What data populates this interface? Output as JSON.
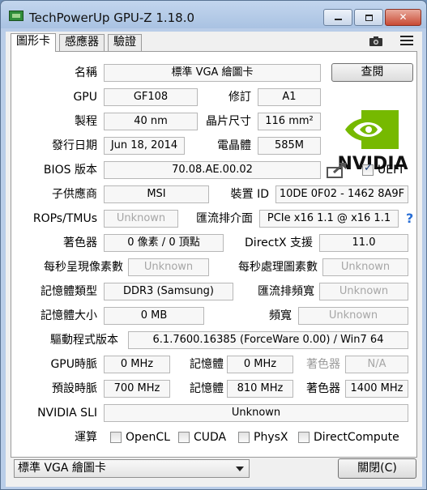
{
  "window": {
    "title": "TechPowerUp GPU-Z 1.18.0",
    "minimize_icon": "minimize-icon",
    "maximize_icon": "maximize-icon",
    "close_glyph": "✕"
  },
  "tabs": [
    {
      "label": "圖形卡",
      "active": true
    },
    {
      "label": "感應器",
      "active": false
    },
    {
      "label": "驗證",
      "active": false
    }
  ],
  "toolbar": {
    "camera_icon": "camera-icon",
    "menu_icon": "hamburger-menu-icon"
  },
  "card": {
    "name_label": "名稱",
    "name_value": "標準 VGA 繪圖卡",
    "lookup_button": "查閱",
    "gpu_label": "GPU",
    "gpu_value": "GF108",
    "revision_label": "修訂",
    "revision_value": "A1",
    "process_label": "製程",
    "process_value": "40 nm",
    "die_size_label": "晶片尺寸",
    "die_size_value": "116 mm²",
    "release_label": "發行日期",
    "release_value": "Jun 18, 2014",
    "transistors_label": "電晶體",
    "transistors_value": "585M",
    "bios_label": "BIOS 版本",
    "bios_value": "70.08.AE.00.02",
    "uefi_label": "UEFI",
    "uefi_checked": true,
    "subvendor_label": "子供應商",
    "subvendor_value": "MSI",
    "device_id_label": "裝置 ID",
    "device_id_value": "10DE 0F02 - 1462 8A9F",
    "rops_label": "ROPs/TMUs",
    "rops_value": "Unknown",
    "bus_label": "匯流排介面",
    "bus_value": "PCIe x16 1.1 @ x16 1.1",
    "shaders_label": "著色器",
    "shaders_value": "0 像素 / 0 頂點",
    "directx_label": "DirectX 支援",
    "directx_value": "11.0",
    "pixel_fill_label": "每秒呈現像素數",
    "pixel_fill_value": "Unknown",
    "texture_fill_label": "每秒處理圖素數",
    "texture_fill_value": "Unknown",
    "mem_type_label": "記憶體類型",
    "mem_type_value": "DDR3 (Samsung)",
    "bus_width_label": "匯流排頻寬",
    "bus_width_value": "Unknown",
    "mem_size_label": "記憶體大小",
    "mem_size_value": "0 MB",
    "bandwidth_label": "頻寬",
    "bandwidth_value": "Unknown",
    "driver_label": "驅動程式版本",
    "driver_value": "6.1.7600.16385 (ForceWare 0.00) / Win7 64",
    "gpu_clock_label": "GPU時脈",
    "gpu_clock_value": "0 MHz",
    "mem_clock_label": "記憶體",
    "mem_clock_value": "0 MHz",
    "shader_clock_label": "著色器",
    "shader_clock_value": "N/A",
    "default_clock_label": "預設時脈",
    "default_clock_value": "700 MHz",
    "default_mem_label": "記憶體",
    "default_mem_value": "810 MHz",
    "default_shader_label": "著色器",
    "default_shader_value": "1400 MHz",
    "sli_label": "NVIDIA SLI",
    "sli_value": "Unknown",
    "compute_label": "運算",
    "compute": [
      {
        "label": "OpenCL",
        "checked": false
      },
      {
        "label": "CUDA",
        "checked": false
      },
      {
        "label": "PhysX",
        "checked": false
      },
      {
        "label": "DirectCompute",
        "checked": false
      }
    ],
    "logo_text": "NVIDIA",
    "help_glyph": "?"
  },
  "footer": {
    "select_value": "標準 VGA 繪圖卡",
    "close_button": "關閉(C)"
  },
  "colors": {
    "nvidia_green": "#76b900",
    "title_bar": "#b9cde8",
    "close_red": "#c94b35"
  }
}
